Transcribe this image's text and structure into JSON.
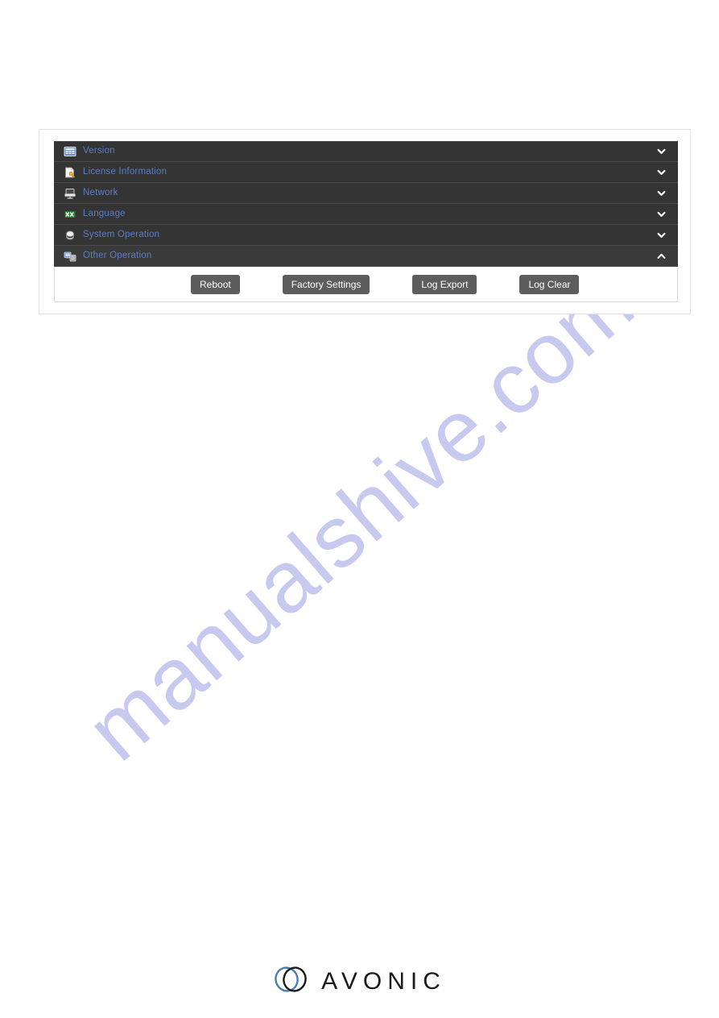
{
  "watermark": {
    "text": "manualshive.com",
    "color": "#c8c9ef"
  },
  "theme": {
    "panel_bg": "#343434",
    "panel_bg_expanded": "#3a3a3a",
    "label_color": "#5a7fc4",
    "button_bg": "#5d5d5d",
    "card_border": "#e2e2e2",
    "logo_blue": "#4d7cb5"
  },
  "accordion": {
    "panels": [
      {
        "label": "Version",
        "icon": "version-icon",
        "expanded": false,
        "chevron": "chevron-down-icon"
      },
      {
        "label": "License Information",
        "icon": "license-document-icon",
        "expanded": false,
        "chevron": "chevron-down-icon"
      },
      {
        "label": "Network",
        "icon": "network-server-icon",
        "expanded": false,
        "chevron": "chevron-down-icon"
      },
      {
        "label": "Language",
        "icon": "language-icon",
        "expanded": false,
        "chevron": "chevron-down-icon"
      },
      {
        "label": "System Operation",
        "icon": "system-operation-icon",
        "expanded": false,
        "chevron": "chevron-down-icon"
      },
      {
        "label": "Other Operation",
        "icon": "other-operation-icon",
        "expanded": true,
        "chevron": "chevron-up-icon"
      }
    ]
  },
  "other_operation": {
    "buttons": [
      {
        "label": "Reboot"
      },
      {
        "label": "Factory Settings"
      },
      {
        "label": "Log Export"
      },
      {
        "label": "Log Clear"
      }
    ]
  },
  "footer": {
    "brand": "AVONIC"
  }
}
